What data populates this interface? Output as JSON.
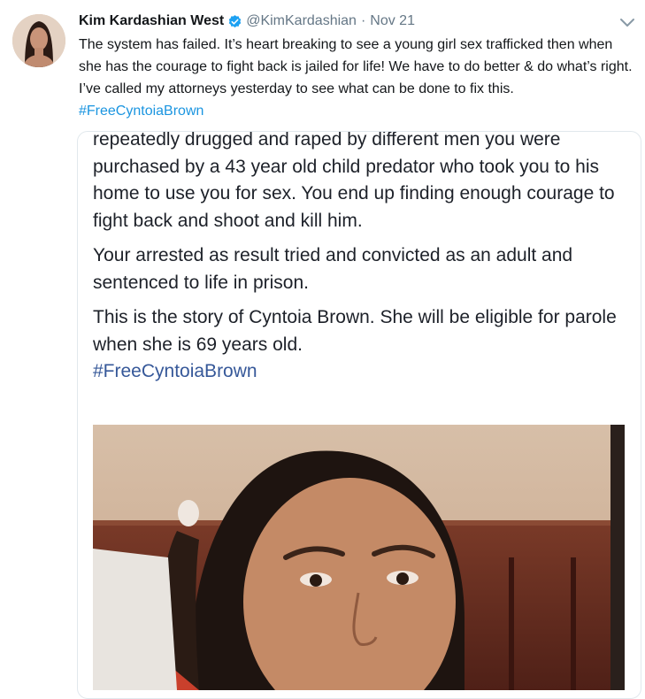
{
  "tweet": {
    "author_name": "Kim Kardashian West",
    "handle": "@KimKardashian",
    "separator": "·",
    "date": "Nov 21",
    "text": "The system has failed. It’s heart breaking to see a young girl sex trafficked then when she has the courage to fight back is jailed for life! We have to do better & do what’s right. I’ve called my attorneys yesterday to see what can be done to fix this.",
    "hashtag": "#FreeCyntoiaBrown"
  },
  "embedded": {
    "para1": "repeatedly drugged and raped by different men you were purchased by a 43 year old child predator who took you to his home to use you for sex. You end up finding enough courage to fight back and shoot and kill him.",
    "para2": "Your arrested as result tried and convicted as an adult and sentenced to life in prison.",
    "para3": "This is the story of Cyntoia Brown. She will be eligible for parole when she is 69 years old.",
    "hashtag": "#FreeCyntoiaBrown"
  },
  "icons": {
    "verified": "verified-badge-icon",
    "more": "chevron-down-icon"
  },
  "colors": {
    "link": "#1b95e0",
    "secondary_text": "#657786",
    "verified": "#1da1f2",
    "fb_hashtag": "#365899"
  }
}
